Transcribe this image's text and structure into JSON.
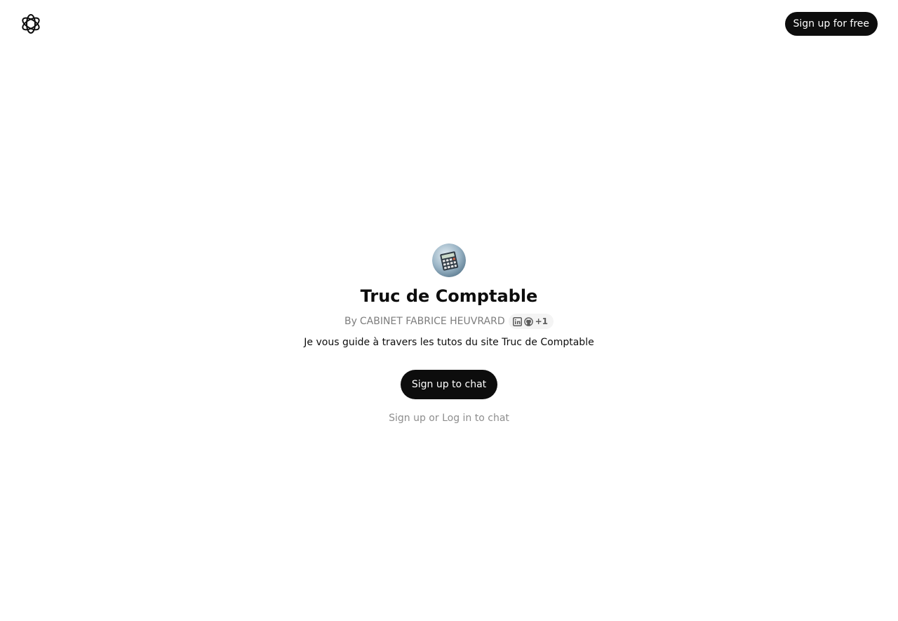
{
  "header": {
    "logo_icon": "openai-logo-icon",
    "signup_label": "Sign up for free"
  },
  "gpt": {
    "avatar_icon": "calculator-icon",
    "title": "Truc de Comptable",
    "by_prefix": "By",
    "author": "CABINET FABRICE HEUVRARD",
    "social": {
      "icons": [
        "linkedin-icon",
        "github-icon"
      ],
      "extra_count": "+1"
    },
    "description": "Je vous guide à travers les tutos du site Truc de Comptable"
  },
  "actions": {
    "signup_chat_label": "Sign up to chat",
    "footer_signup": "Sign up",
    "footer_or": "or",
    "footer_login": "Log in",
    "footer_suffix": "to chat"
  },
  "colors": {
    "primary_button": "#0d0d0d",
    "muted_text": "#7d7d7d",
    "pill_background": "#f4f4f4"
  }
}
